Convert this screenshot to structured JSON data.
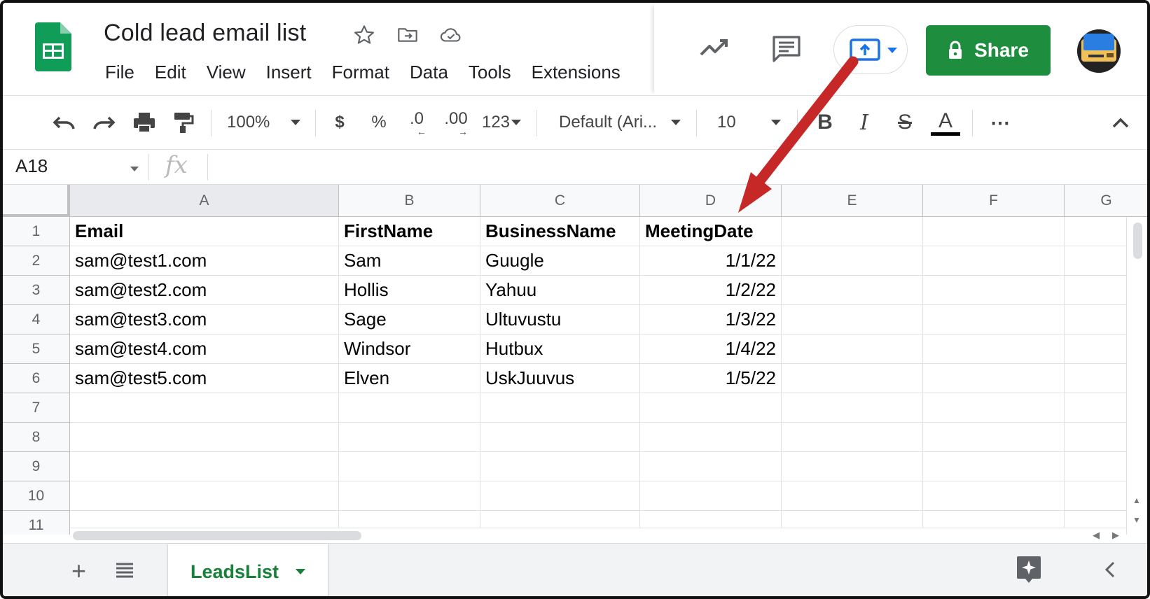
{
  "app": {
    "doc_title": "Cold lead email list",
    "brand_color": "#0f9d58",
    "icons": [
      "star-icon",
      "move-to-folder-icon",
      "cloud-saved-icon"
    ]
  },
  "menu": [
    "File",
    "Edit",
    "View",
    "Insert",
    "Format",
    "Data",
    "Tools",
    "Extensions"
  ],
  "header_actions": {
    "share_label": "Share",
    "share_color": "#1e8e3e",
    "icons": [
      "activity-trend-icon",
      "comment-icon",
      "present-icon",
      "lock-icon",
      "avatar"
    ]
  },
  "toolbar": {
    "zoom": "100%",
    "currency": "$",
    "percent": "%",
    "decrease_decimal": ".0",
    "increase_decimal": ".00",
    "more_formats": "123",
    "font": "Default (Ari...",
    "font_size": "10",
    "bold": "B",
    "italic": "I",
    "strike": "S",
    "text_color": "A",
    "more": "⋯"
  },
  "formula_bar": {
    "name_box": "A18",
    "fx": "fx",
    "value": ""
  },
  "grid": {
    "columns": [
      "A",
      "B",
      "C",
      "D",
      "E",
      "F",
      "G"
    ],
    "rows": [
      "1",
      "2",
      "3",
      "4",
      "5",
      "6",
      "7",
      "8",
      "9",
      "10",
      "11"
    ],
    "cells": [
      [
        "Email",
        "FirstName",
        "BusinessName",
        "MeetingDate"
      ],
      [
        "sam@test1.com",
        "Sam",
        "Guugle",
        "1/1/22"
      ],
      [
        "sam@test2.com",
        "Hollis",
        "Yahuu",
        "1/2/22"
      ],
      [
        "sam@test3.com",
        "Sage",
        "Ultuvustu",
        "1/3/22"
      ],
      [
        "sam@test4.com",
        "Windsor",
        "Hutbux",
        "1/4/22"
      ],
      [
        "sam@test5.com",
        "Elven",
        "UskJuuvus",
        "1/5/22"
      ]
    ]
  },
  "sheet_tabs": {
    "active": "LeadsList",
    "active_color": "#188038"
  },
  "annotation": {
    "arrow_color": "#c62828",
    "points_to": "MeetingDate"
  }
}
